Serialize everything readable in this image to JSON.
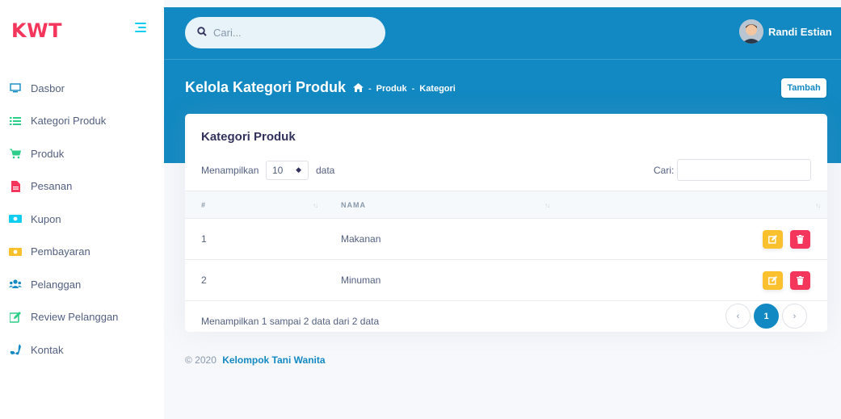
{
  "sidebar": {
    "brand": "KWT",
    "items": [
      {
        "label": "Dasbor",
        "icon": "monitor-icon"
      },
      {
        "label": "Kategori Produk",
        "icon": "list-icon"
      },
      {
        "label": "Produk",
        "icon": "cart-icon"
      },
      {
        "label": "Pesanan",
        "icon": "document-icon"
      },
      {
        "label": "Kupon",
        "icon": "money-icon"
      },
      {
        "label": "Pembayaran",
        "icon": "money-icon"
      },
      {
        "label": "Pelanggan",
        "icon": "users-icon"
      },
      {
        "label": "Review Pelanggan",
        "icon": "edit-icon"
      },
      {
        "label": "Kontak",
        "icon": "phone-icon"
      }
    ]
  },
  "header": {
    "search_placeholder": "Cari...",
    "user_name": "Randi Estian",
    "page_title": "Kelola Kategori Produk",
    "breadcrumb": [
      "Produk",
      "Kategori"
    ],
    "breadcrumb_sep": "-",
    "add_button": "Tambah"
  },
  "card": {
    "title": "Kategori Produk",
    "length_label": "Menampilkan",
    "length_value": "10",
    "length_suffix": "data",
    "filter_label": "Cari:",
    "columns": [
      "#",
      "NAMA"
    ],
    "rows": [
      {
        "no": "1",
        "nama": "Makanan"
      },
      {
        "no": "2",
        "nama": "Minuman"
      }
    ],
    "info": "Menampilkan 1 sampai 2 data dari 2 data",
    "pagination": {
      "prev": "‹",
      "current": "1",
      "next": "›"
    }
  },
  "footer": {
    "copyright": "© 2020",
    "brand": "Kelompok Tani Wanita"
  },
  "colors": {
    "primary": "#1289c2",
    "brand_red": "#f5365c",
    "edit_yellow": "#fbc02d",
    "delete_red": "#f5365c",
    "sidebar_icon_teal": "#11cdef",
    "sidebar_icon_orange": "#fb6340"
  }
}
